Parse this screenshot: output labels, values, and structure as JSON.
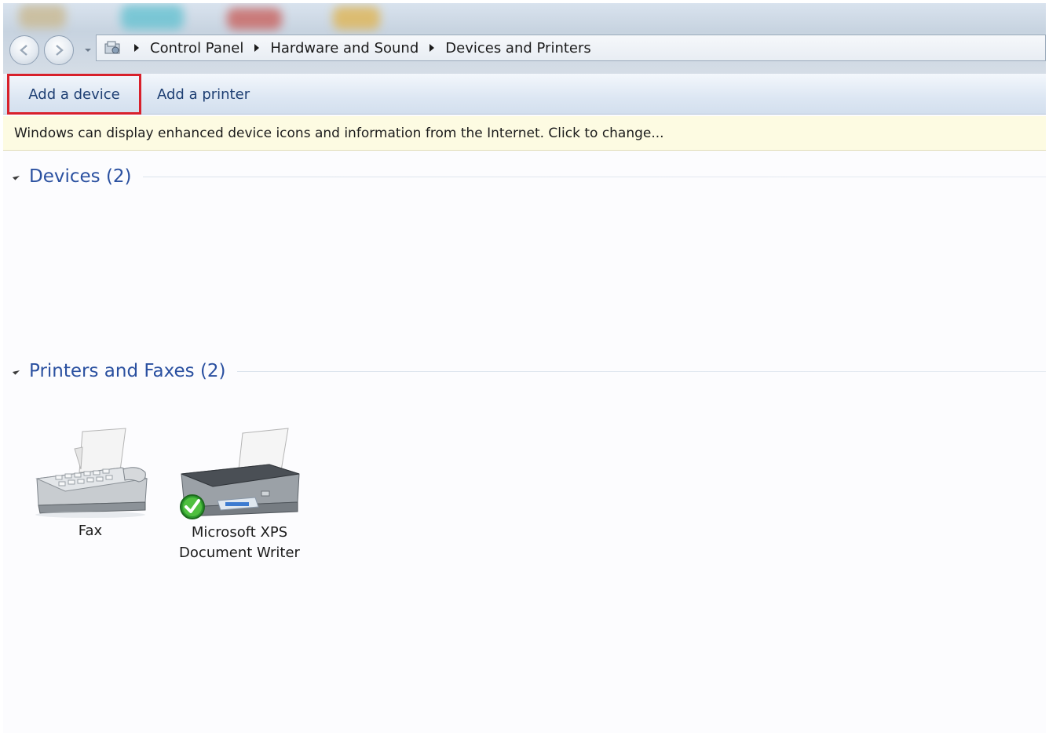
{
  "window": {
    "nav": {
      "back_icon": "back-arrow-icon",
      "forward_icon": "forward-arrow-icon",
      "recent_icon": "chevron-down-icon"
    },
    "address": {
      "root_icon": "control-panel-icon",
      "breadcrumbs": [
        "Control Panel",
        "Hardware and Sound",
        "Devices and Printers"
      ]
    }
  },
  "commandbar": {
    "add_device": "Add a device",
    "add_printer": "Add a printer"
  },
  "infobar": {
    "message": "Windows can display enhanced device icons and information from the Internet. Click to change..."
  },
  "groups": {
    "devices": {
      "title": "Devices (2)"
    },
    "printers": {
      "title": "Printers and Faxes (2)",
      "items": [
        {
          "label": "Fax",
          "icon": "fax-icon"
        },
        {
          "label_line1": "Microsoft XPS",
          "label_line2": "Document Writer",
          "icon": "printer-icon",
          "badge": "default-check-icon"
        }
      ]
    }
  },
  "colors": {
    "accent_link": "#2a50a0",
    "highlight_border": "#d8202b",
    "infobar_bg": "#fdfbe2",
    "check_green": "#2e9b2e"
  }
}
